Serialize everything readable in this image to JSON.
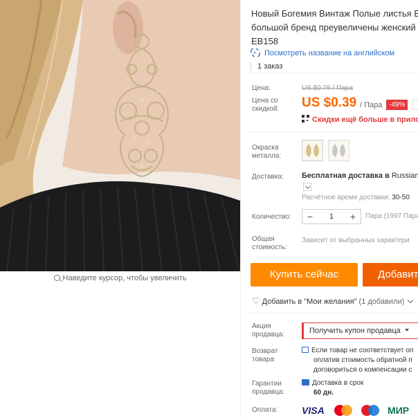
{
  "image": {
    "zoom_hint": "Наведите курсор, чтобы увеличить"
  },
  "product": {
    "title_lines": [
      "Новый Богемия Винтаж Полые листья Е",
      "большой бренд преувеличены женский",
      "EB158"
    ],
    "translate_link": "Посмотреть название на английском",
    "orders": "1 заказ"
  },
  "price": {
    "label": "Цена:",
    "old": "US $0.76 / Пара",
    "discount_label": "Цена со скидкой:",
    "current": "US $0.39",
    "per_unit": "/ Пара",
    "discount_badge": "-49%",
    "app_promo": "Скидки ещё больше в приложе"
  },
  "color": {
    "label": "Окраска металла:",
    "options": [
      "gold",
      "silver"
    ]
  },
  "delivery": {
    "label": "Доставка:",
    "value_prefix": "Бесплатная доставка в",
    "value_dest": "Russian F",
    "time_label": "Расчётное время доставки:",
    "time_value": "30-50"
  },
  "quantity": {
    "label": "Количество:",
    "value": "1",
    "note": "Пара (1997 Пара"
  },
  "total": {
    "label": "Общая стоимость:",
    "note": "Зависит от выбранных характери"
  },
  "actions": {
    "buy_now": "Купить сейчас",
    "add_to_cart": "Добавит",
    "wishlist": "Добавить в \"Мои желания\"",
    "wishlist_count": "(1 добавили)"
  },
  "promo": {
    "label": "Акция продавца:",
    "coupon": "Получить купон продавца"
  },
  "returns": {
    "label": "Возврат товара",
    "lines": [
      "Если товар не соответствует оп",
      "оплатив стоимость обратной п",
      "договориться о компенсации с"
    ]
  },
  "guarantee": {
    "label": "Гарантии продавца:",
    "line": "Доставка в срок",
    "days": "60 дн."
  },
  "payment": {
    "label": "Оплата:",
    "visa": "VISA",
    "mir": "МИР"
  }
}
